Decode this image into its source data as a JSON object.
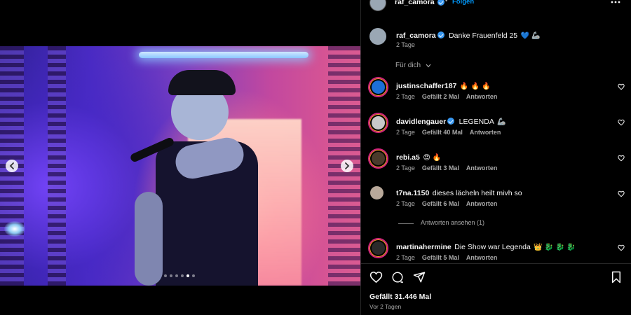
{
  "post": {
    "author": "raf_camora",
    "follow_label": "Folgen",
    "caption_user": "raf_camora",
    "caption_text": "Danke Frauenfeld 25",
    "caption_emojis": "💙 🦾",
    "caption_time": "2 Tage",
    "sort_label": "Für dich",
    "likes": "Gefällt 31.446 Mal",
    "posted": "Vor 2 Tagen",
    "carousel_count": 6,
    "carousel_active": 4
  },
  "comments": [
    {
      "user": "justinschaffer187",
      "verified": false,
      "text": "",
      "emojis": "🔥 🔥 🔥",
      "time": "2 Tage",
      "likes": "Gefällt 2 Mal",
      "reply": "Antworten",
      "avatar_color": "#1d6fd6"
    },
    {
      "user": "davidlengauer",
      "verified": true,
      "text": "LEGENDA",
      "emojis": "🦾",
      "time": "2 Tage",
      "likes": "Gefällt 40 Mal",
      "reply": "Antworten",
      "avatar_color": "#c9c9c9"
    },
    {
      "user": "rebi.a5",
      "verified": false,
      "text": "",
      "emojis": "😍 🔥",
      "time": "2 Tage",
      "likes": "Gefällt 3 Mal",
      "reply": "Antworten",
      "avatar_color": "#4a3a2a"
    },
    {
      "user": "t7na.1150",
      "verified": false,
      "text": "dieses lächeln heilt mivh so",
      "emojis": "",
      "time": "2 Tage",
      "likes": "Gefällt 6 Mal",
      "reply": "Antworten",
      "avatar_color": "#b9a99a"
    },
    {
      "user": "martinahermine",
      "verified": false,
      "text": "Die Show war Legenda",
      "emojis": "👑 🐉 🐉 🐉",
      "time": "2 Tage",
      "likes": "Gefällt 5 Mal",
      "reply": "Antworten",
      "avatar_color": "#2a2a2a"
    }
  ],
  "view_replies": "Antworten ansehen (1)",
  "colors": {
    "accent": "#0095f6",
    "verified": "#3897f0",
    "muted": "#a8a8a8"
  },
  "icons": [
    "more-icon",
    "chevron-down-icon",
    "heart-icon",
    "comment-icon",
    "share-icon",
    "bookmark-icon",
    "chevron-left-icon",
    "chevron-right-icon"
  ]
}
